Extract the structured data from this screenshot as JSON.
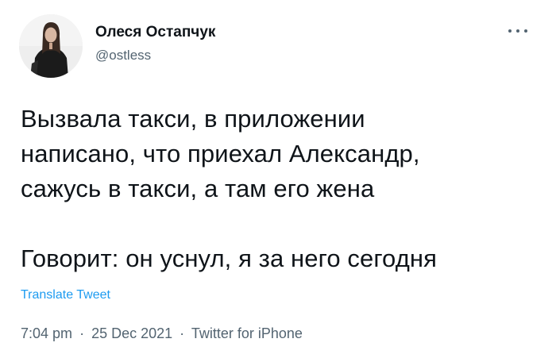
{
  "author": {
    "name": "Олеся Остапчук",
    "handle": "@ostless"
  },
  "tweet": {
    "lines": [
      "Вызвала такси, в приложении",
      "написано, что приехал Александр,",
      "сажусь в такси, а там его жена",
      "Говорит: он уснул, я за него сегодня"
    ],
    "translate_label": "Translate Tweet",
    "time": "7:04 pm",
    "date": "25 Dec 2021",
    "source": "Twitter for iPhone",
    "separator": "·"
  },
  "icons": {
    "more": "more-dots-icon",
    "avatar": "profile-photo"
  },
  "colors": {
    "text": "#0f1419",
    "secondary": "#536471",
    "link": "#1d9bf0"
  }
}
